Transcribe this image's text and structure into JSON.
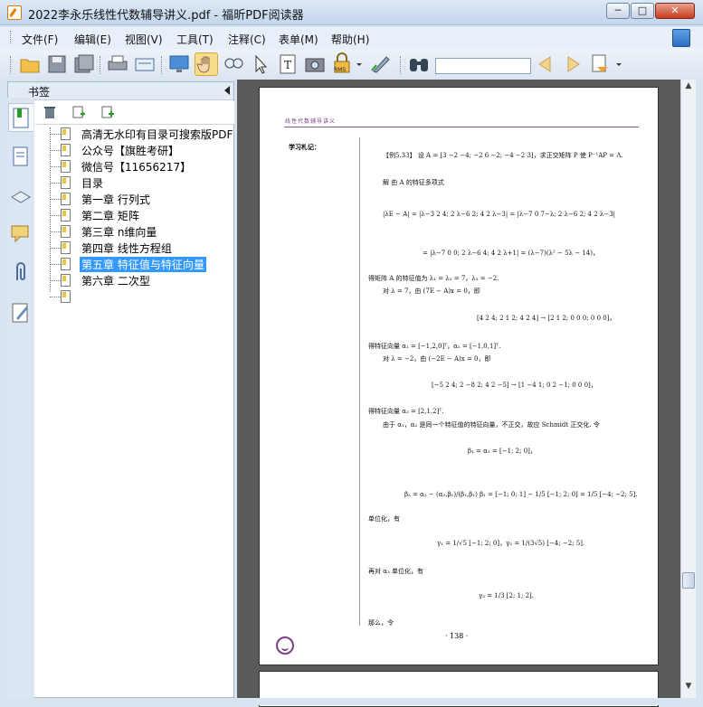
{
  "window": {
    "title": "2022李永乐线性代数辅导讲义.pdf - 福昕PDF阅读器",
    "min": "─",
    "max": "□",
    "close": "✕"
  },
  "menu": [
    {
      "label": "文件(F)"
    },
    {
      "label": "编辑(E)"
    },
    {
      "label": "视图(V)"
    },
    {
      "label": "工具(T)"
    },
    {
      "label": "注释(C)"
    },
    {
      "label": "表单(M)"
    },
    {
      "label": "帮助(H)"
    }
  ],
  "toolbar": {
    "icons": [
      "open-folder-icon",
      "save-icon",
      "save-all-icon",
      "print-icon",
      "scan-icon",
      "screen-icon",
      "hand-tool-icon",
      "loupe-icon",
      "select-cursor-icon",
      "text-select-icon",
      "snapshot-camera-icon",
      "rms-lock-icon",
      "sign-pen-icon",
      "find-binoculars-icon",
      "prev-result-icon",
      "next-result-icon",
      "highlight-icon"
    ],
    "search_value": "",
    "rms_label": "RMS"
  },
  "bookmarks": {
    "title": "书签",
    "items": [
      {
        "label": "高清无水印有目录可搜索版PDF"
      },
      {
        "label": "公众号【旗胜考研】"
      },
      {
        "label": "微信号【11656217】"
      },
      {
        "label": "目录"
      },
      {
        "label": "第一章 行列式"
      },
      {
        "label": "第二章 矩阵"
      },
      {
        "label": "第三章 n维向量"
      },
      {
        "label": "第四章 线性方程组"
      },
      {
        "label": "第五章 特征值与特征向量",
        "selected": true
      },
      {
        "label": "第六章 二次型"
      },
      {
        "label": ""
      }
    ]
  },
  "page": {
    "header": "线性代数辅导讲义",
    "note_label": "学习札记：",
    "page_number": "· 138 ·",
    "lines": [
      "【例5.33】 设 A = [3 −2 −4; −2 6 −2; −4 −2 3]，求正交矩阵 P 使 P⁻¹AP = Λ.",
      "解  由 A 的特征多项式",
      "|λE − A| = |λ−3 2 4; 2 λ−6 2; 4 2 λ−3| = |λ−7 0 7−λ; 2 λ−6 2; 4 2 λ−3|",
      "= |λ−7 0 0; 2 λ−6 4; 4 2 λ+1| = (λ−7)(λ² − 5λ − 14)，",
      "得矩阵 A 的特征值为 λ₁ = λ₂ = 7，λ₃ = −2.",
      "对 λ = 7，由 (7E − A)x = 0，即",
      "[4 2 4; 2 1 2; 4 2 4] → [2 1 2; 0 0 0; 0 0 0]，",
      "得特征向量 α₁ = [−1,2,0]ᵀ，α₂ = [−1,0,1]ᵀ.",
      "对 λ = −2，由 (−2E − A)x = 0，即",
      "[−5 2 4; 2 −8 2; 4 2 −5] → [1 −4 1; 0 2 −1; 0 0 0]，",
      "得特征向量 α₃ = [2,1,2]ᵀ.",
      "由于 α₁，α₂ 是同一个特征值的特征向量，不正交，故应 Schmidt 正交化. 令",
      "β₁ = α₁ = [−1; 2; 0]，",
      "β₂ = α₂ − (α₂,β₁)/(β₁,β₁) β₁ = [−1; 0; 1] − 1/5 [−1; 2; 0] = 1/5 [−4; −2; 5].",
      "单位化，有",
      "γ₁ = 1/√5 [−1; 2; 0]，γ₂ = 1/(3√5) [−4; −2; 5].",
      "再对 α₃ 单位化，有",
      "γ₃ = 1/3 [2; 1; 2].",
      "那么，令"
    ]
  }
}
